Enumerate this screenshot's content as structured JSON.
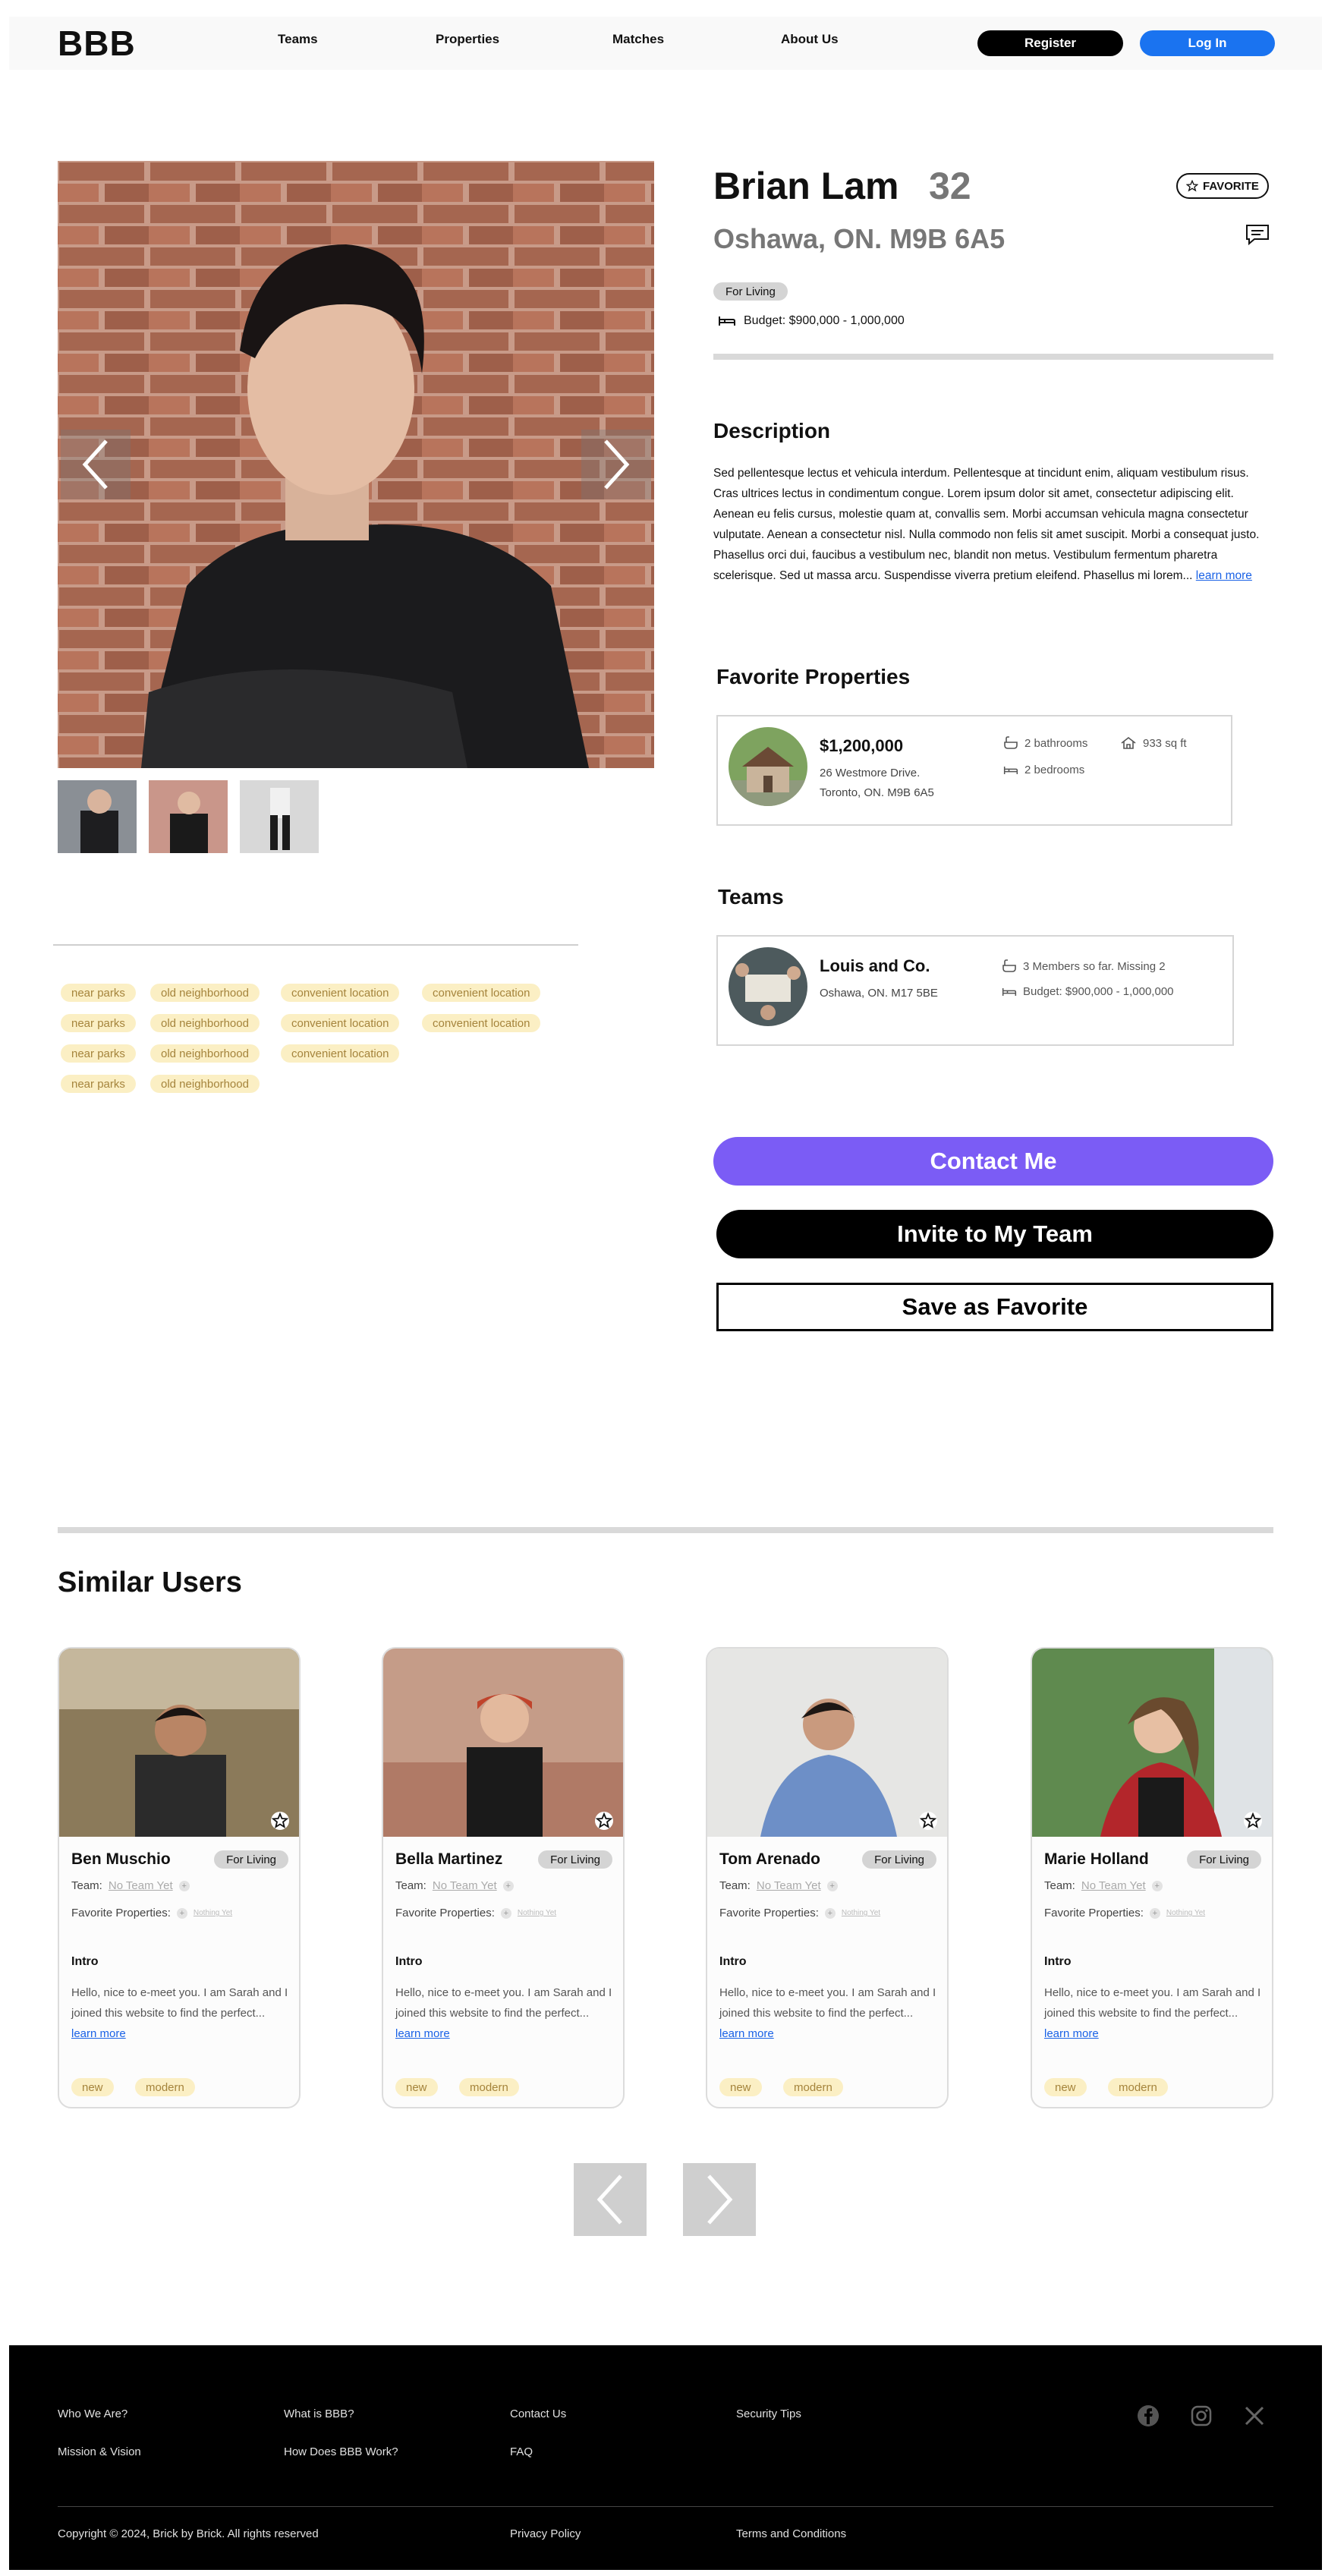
{
  "nav": {
    "logo": "BBB",
    "links": [
      "Teams",
      "Properties",
      "Matches",
      "About Us"
    ],
    "register": "Register",
    "login": "Log In"
  },
  "profile": {
    "name": "Brian Lam",
    "age": "32",
    "favorite_label": "FAVORITE",
    "location": "Oshawa, ON. M9B 6A5",
    "purpose": "For Living",
    "budget": "Budget: $900,000 - 1,000,000",
    "description_heading": "Description",
    "description": "Sed pellentesque lectus et vehicula interdum. Pellentesque at tincidunt enim, aliquam vestibulum risus. Cras ultrices lectus in condimentum congue. Lorem ipsum dolor sit amet, consectetur adipiscing elit. Aenean eu felis cursus, molestie quam at, convallis sem. Morbi accumsan vehicula magna consectetur vulputate. Aenean a consectetur nisl. Nulla commodo non felis sit amet suscipit. Morbi a consequat justo. Phasellus orci dui, faucibus a vestibulum nec, blandit non metus. Vestibulum fermentum pharetra scelerisque. Sed ut massa arcu. Suspendisse viverra pretium eleifend. Phasellus mi lorem...",
    "learn_more": "learn more",
    "tags": [
      [
        "near parks",
        "old neighborhood",
        "convenient location",
        "convenient location"
      ],
      [
        "near parks",
        "old neighborhood",
        "convenient location",
        "convenient location"
      ],
      [
        "near parks",
        "old neighborhood",
        "convenient location"
      ],
      [
        "near parks",
        "old neighborhood"
      ]
    ]
  },
  "favorite_properties": {
    "heading": "Favorite Properties",
    "price": "$1,200,000",
    "address1": "26 Westmore Drive.",
    "address2": "Toronto, ON. M9B 6A5",
    "bathrooms": "2 bathrooms",
    "area": "933 sq ft",
    "bedrooms": "2 bedrooms"
  },
  "teams": {
    "heading": "Teams",
    "name": "Louis and Co.",
    "location": "Oshawa, ON. M17 5BE",
    "members": "3 Members so far. Missing 2",
    "budget": "Budget: $900,000 - 1,000,000"
  },
  "actions": {
    "contact": "Contact Me",
    "invite": "Invite to My Team",
    "save": "Save as Favorite"
  },
  "similar": {
    "heading": "Similar Users",
    "team_label": "Team:",
    "team_value": "No Team Yet",
    "fav_label": "Favorite Properties:",
    "fav_value": "Nothing Yet",
    "intro_heading": "Intro",
    "intro_text": "Hello, nice to e-meet you. I am Sarah and I joined this website to find the perfect...",
    "learn_more": "learn more",
    "purpose": "For Living",
    "tags": [
      "new",
      "modern"
    ],
    "users": [
      {
        "name": "Ben Muschio"
      },
      {
        "name": "Bella Martinez"
      },
      {
        "name": "Tom Arenado"
      },
      {
        "name": "Marie Holland"
      }
    ]
  },
  "footer": {
    "col1": [
      "Who We Are?",
      "Mission & Vision"
    ],
    "col2": [
      "What is BBB?",
      "How Does BBB Work?"
    ],
    "col3": [
      "Contact Us",
      "FAQ"
    ],
    "col4": [
      "Security Tips"
    ],
    "copyright": "Copyright © 2024, Brick by Brick. All rights reserved",
    "privacy": "Privacy Policy",
    "terms": "Terms and Conditions",
    "social": [
      "facebook-icon",
      "instagram-icon",
      "x-icon"
    ]
  },
  "colors": {
    "accent_purple": "#7b5cf5",
    "brand_blue": "#1a73f0",
    "tag_bg": "#fbefc4",
    "tag_text": "#a5843c"
  }
}
